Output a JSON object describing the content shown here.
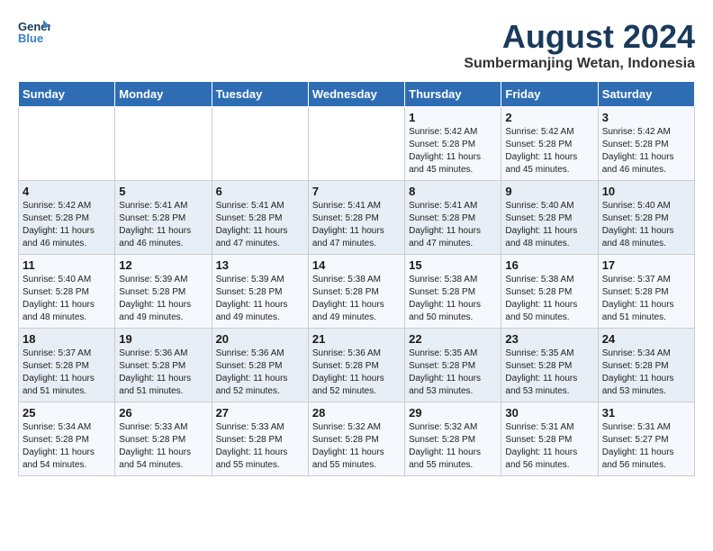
{
  "header": {
    "logo_line1": "General",
    "logo_line2": "Blue",
    "title": "August 2024",
    "subtitle": "Sumbermanjing Wetan, Indonesia"
  },
  "calendar": {
    "days_of_week": [
      "Sunday",
      "Monday",
      "Tuesday",
      "Wednesday",
      "Thursday",
      "Friday",
      "Saturday"
    ],
    "weeks": [
      [
        {
          "day": "",
          "info": ""
        },
        {
          "day": "",
          "info": ""
        },
        {
          "day": "",
          "info": ""
        },
        {
          "day": "",
          "info": ""
        },
        {
          "day": "1",
          "info": "Sunrise: 5:42 AM\nSunset: 5:28 PM\nDaylight: 11 hours\nand 45 minutes."
        },
        {
          "day": "2",
          "info": "Sunrise: 5:42 AM\nSunset: 5:28 PM\nDaylight: 11 hours\nand 45 minutes."
        },
        {
          "day": "3",
          "info": "Sunrise: 5:42 AM\nSunset: 5:28 PM\nDaylight: 11 hours\nand 46 minutes."
        }
      ],
      [
        {
          "day": "4",
          "info": "Sunrise: 5:42 AM\nSunset: 5:28 PM\nDaylight: 11 hours\nand 46 minutes."
        },
        {
          "day": "5",
          "info": "Sunrise: 5:41 AM\nSunset: 5:28 PM\nDaylight: 11 hours\nand 46 minutes."
        },
        {
          "day": "6",
          "info": "Sunrise: 5:41 AM\nSunset: 5:28 PM\nDaylight: 11 hours\nand 47 minutes."
        },
        {
          "day": "7",
          "info": "Sunrise: 5:41 AM\nSunset: 5:28 PM\nDaylight: 11 hours\nand 47 minutes."
        },
        {
          "day": "8",
          "info": "Sunrise: 5:41 AM\nSunset: 5:28 PM\nDaylight: 11 hours\nand 47 minutes."
        },
        {
          "day": "9",
          "info": "Sunrise: 5:40 AM\nSunset: 5:28 PM\nDaylight: 11 hours\nand 48 minutes."
        },
        {
          "day": "10",
          "info": "Sunrise: 5:40 AM\nSunset: 5:28 PM\nDaylight: 11 hours\nand 48 minutes."
        }
      ],
      [
        {
          "day": "11",
          "info": "Sunrise: 5:40 AM\nSunset: 5:28 PM\nDaylight: 11 hours\nand 48 minutes."
        },
        {
          "day": "12",
          "info": "Sunrise: 5:39 AM\nSunset: 5:28 PM\nDaylight: 11 hours\nand 49 minutes."
        },
        {
          "day": "13",
          "info": "Sunrise: 5:39 AM\nSunset: 5:28 PM\nDaylight: 11 hours\nand 49 minutes."
        },
        {
          "day": "14",
          "info": "Sunrise: 5:38 AM\nSunset: 5:28 PM\nDaylight: 11 hours\nand 49 minutes."
        },
        {
          "day": "15",
          "info": "Sunrise: 5:38 AM\nSunset: 5:28 PM\nDaylight: 11 hours\nand 50 minutes."
        },
        {
          "day": "16",
          "info": "Sunrise: 5:38 AM\nSunset: 5:28 PM\nDaylight: 11 hours\nand 50 minutes."
        },
        {
          "day": "17",
          "info": "Sunrise: 5:37 AM\nSunset: 5:28 PM\nDaylight: 11 hours\nand 51 minutes."
        }
      ],
      [
        {
          "day": "18",
          "info": "Sunrise: 5:37 AM\nSunset: 5:28 PM\nDaylight: 11 hours\nand 51 minutes."
        },
        {
          "day": "19",
          "info": "Sunrise: 5:36 AM\nSunset: 5:28 PM\nDaylight: 11 hours\nand 51 minutes."
        },
        {
          "day": "20",
          "info": "Sunrise: 5:36 AM\nSunset: 5:28 PM\nDaylight: 11 hours\nand 52 minutes."
        },
        {
          "day": "21",
          "info": "Sunrise: 5:36 AM\nSunset: 5:28 PM\nDaylight: 11 hours\nand 52 minutes."
        },
        {
          "day": "22",
          "info": "Sunrise: 5:35 AM\nSunset: 5:28 PM\nDaylight: 11 hours\nand 53 minutes."
        },
        {
          "day": "23",
          "info": "Sunrise: 5:35 AM\nSunset: 5:28 PM\nDaylight: 11 hours\nand 53 minutes."
        },
        {
          "day": "24",
          "info": "Sunrise: 5:34 AM\nSunset: 5:28 PM\nDaylight: 11 hours\nand 53 minutes."
        }
      ],
      [
        {
          "day": "25",
          "info": "Sunrise: 5:34 AM\nSunset: 5:28 PM\nDaylight: 11 hours\nand 54 minutes."
        },
        {
          "day": "26",
          "info": "Sunrise: 5:33 AM\nSunset: 5:28 PM\nDaylight: 11 hours\nand 54 minutes."
        },
        {
          "day": "27",
          "info": "Sunrise: 5:33 AM\nSunset: 5:28 PM\nDaylight: 11 hours\nand 55 minutes."
        },
        {
          "day": "28",
          "info": "Sunrise: 5:32 AM\nSunset: 5:28 PM\nDaylight: 11 hours\nand 55 minutes."
        },
        {
          "day": "29",
          "info": "Sunrise: 5:32 AM\nSunset: 5:28 PM\nDaylight: 11 hours\nand 55 minutes."
        },
        {
          "day": "30",
          "info": "Sunrise: 5:31 AM\nSunset: 5:28 PM\nDaylight: 11 hours\nand 56 minutes."
        },
        {
          "day": "31",
          "info": "Sunrise: 5:31 AM\nSunset: 5:27 PM\nDaylight: 11 hours\nand 56 minutes."
        }
      ]
    ]
  }
}
